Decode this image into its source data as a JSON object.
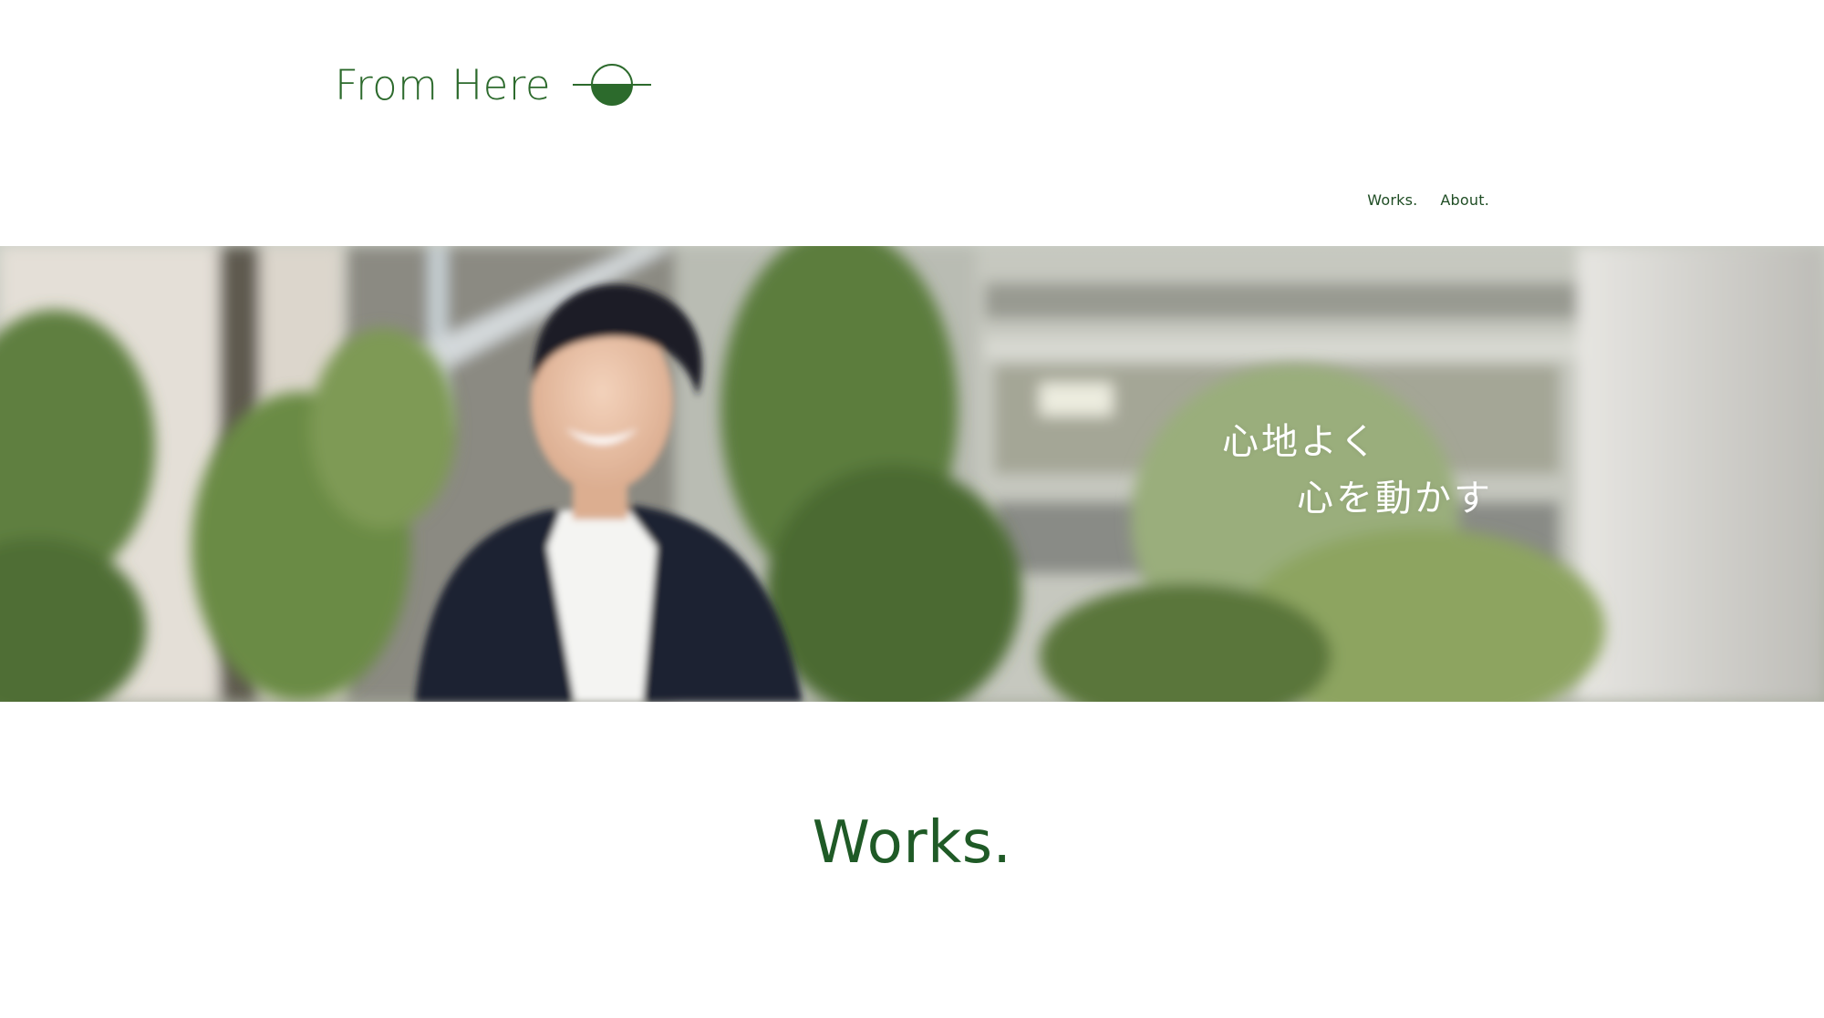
{
  "brand": {
    "name": "From Here",
    "logo_icon": "half-filled-circle-horizon-icon",
    "color": "#2c6a2c"
  },
  "nav": {
    "items": [
      {
        "label": "Works."
      },
      {
        "label": "About."
      }
    ]
  },
  "hero": {
    "image": "smiling-man-outdoors-photo",
    "tagline_line1": "心地よく",
    "tagline_line2": "心を動かす"
  },
  "works": {
    "heading": "Works."
  },
  "colors": {
    "accent": "#1f5a26",
    "nav_text": "#1f4d24",
    "background": "#ffffff"
  }
}
